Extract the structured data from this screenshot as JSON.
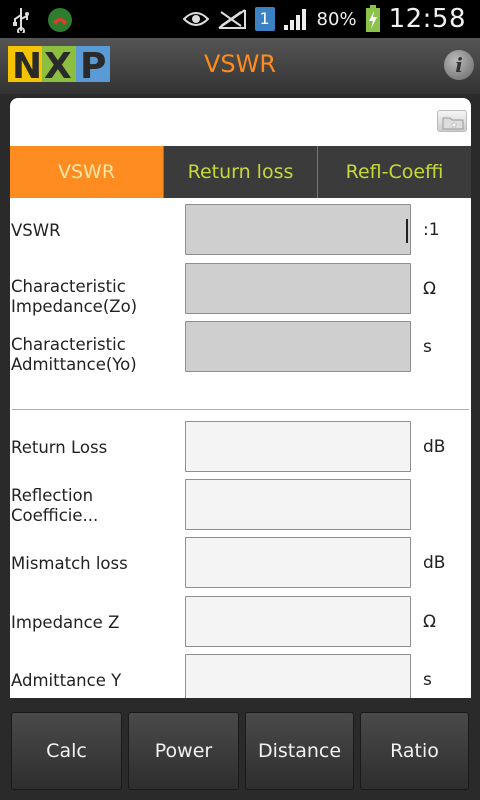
{
  "status_bar": {
    "battery_percent": "80%",
    "notification_count": "1",
    "time": "12:58",
    "icons": [
      "usb-icon",
      "missed-call-icon",
      "eye-icon",
      "no-signal-icon",
      "signal-icon",
      "battery-charging-icon"
    ]
  },
  "title_bar": {
    "logo_text": "NXP",
    "title": "VSWR",
    "info_label": "i"
  },
  "tabs": [
    {
      "label": "VSWR",
      "active": true
    },
    {
      "label": "Return loss",
      "active": false
    },
    {
      "label": "Refl-Coeffi",
      "active": false
    }
  ],
  "fields": [
    {
      "label": "VSWR",
      "unit": ":1",
      "value": "",
      "readonly": true
    },
    {
      "label": "Characteristic Impedance(Zo)",
      "unit": "Ω",
      "value": "",
      "readonly": true
    },
    {
      "label": "Characteristic Admittance(Yo)",
      "unit": "s",
      "value": "",
      "readonly": true
    },
    {
      "label": "Return Loss",
      "unit": "dB",
      "value": ""
    },
    {
      "label": "Reflection Coefficie...",
      "unit": "",
      "value": ""
    },
    {
      "label": "Mismatch loss",
      "unit": "dB",
      "value": ""
    },
    {
      "label": "Impedance Z",
      "unit": "Ω",
      "value": ""
    },
    {
      "label": "Admittance Y",
      "unit": "s",
      "value": ""
    }
  ],
  "bottom_buttons": [
    "Calc",
    "Power",
    "Distance",
    "Ratio"
  ],
  "colors": {
    "accent_orange": "#ff8c21",
    "tab_text": "#c7d93a",
    "separator": "#ff9a3a"
  }
}
